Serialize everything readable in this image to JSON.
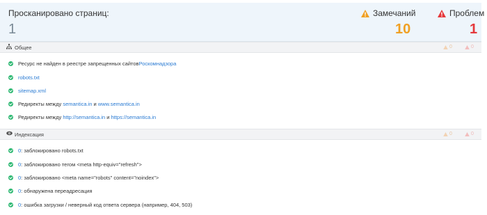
{
  "stats": {
    "scanned_label": "Просканировано страниц:",
    "scanned_value": "1",
    "warnings_label": "Замечаний",
    "warnings_value": "10",
    "problems_label": "Проблем",
    "problems_value": "1"
  },
  "colors": {
    "warning": "#f0a023",
    "error": "#e5383b",
    "success": "#2eb872",
    "link": "#2a7bd3"
  },
  "general": {
    "title": "Общее",
    "icon": "sitemap-icon",
    "warn_count": "0",
    "err_count": "0",
    "rows": [
      {
        "text": "Ресурс не найден в реестре запрещенных сайтов ",
        "link": "Роскомнадзора"
      },
      {
        "link": "robots.txt"
      },
      {
        "link": "sitemap.xml"
      },
      {
        "text": "Редиректы между ",
        "link1": "semantica.in",
        "mid": " и ",
        "link2": "www.semantica.in"
      },
      {
        "text": "Редиректы между ",
        "link1": "http://semantica.in",
        "mid": " и ",
        "link2": "https://semantica.in"
      }
    ]
  },
  "indexing": {
    "title": "Индексация",
    "icon": "eye-icon",
    "warn_count": "0",
    "err_count": "0",
    "rows": [
      {
        "count": "0",
        "text": ": заблокировано robots.txt"
      },
      {
        "count": "0",
        "text": ": заблокировано тегом <meta http-equiv=\"refresh\">"
      },
      {
        "count": "0",
        "text": ": заблокировано <meta name=\"robots\" content=\"noindex\">"
      },
      {
        "count": "0",
        "text": ": обнаружена переадресация"
      },
      {
        "count": "0",
        "text": ": ошибка загрузки / неверный код ответа сервера (например, 404, 503)"
      }
    ]
  }
}
